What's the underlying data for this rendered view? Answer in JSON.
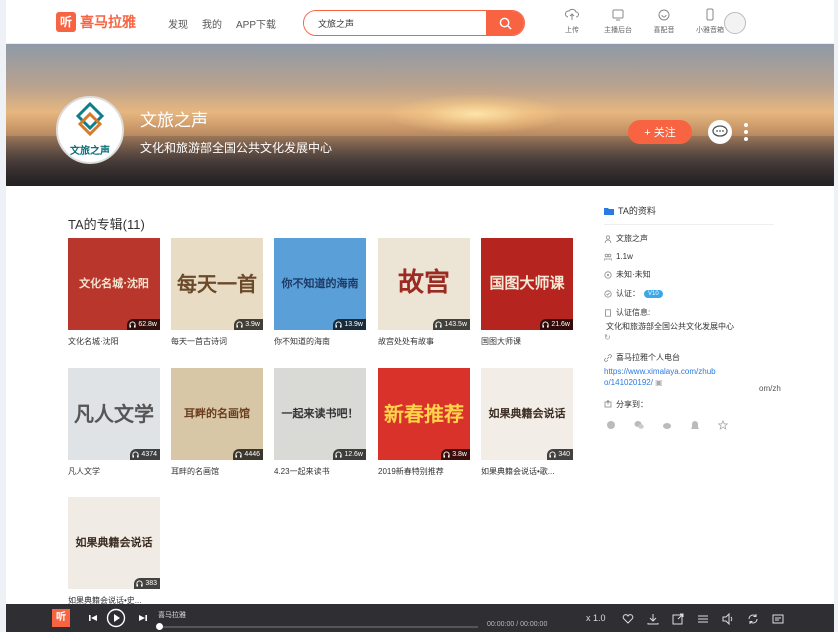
{
  "topbar": {
    "logo_mark": "听",
    "logo_text": "喜马拉雅",
    "nav": [
      "发现",
      "我的",
      "APP下载"
    ],
    "search_value": "文旅之声",
    "tools": [
      {
        "icon": "upload-icon",
        "label": "上传"
      },
      {
        "icon": "anchor-backend-icon",
        "label": "主播后台"
      },
      {
        "icon": "dubbing-icon",
        "label": "喜配音"
      },
      {
        "icon": "mini-program-icon",
        "label": "小雅音箱"
      }
    ]
  },
  "banner": {
    "avatar_text": "文旅之声",
    "title": "文旅之声",
    "subtitle": "文化和旅游部全国公共文化发展中心",
    "follow_label": "+ 关注"
  },
  "albums": {
    "heading": "TA的专辑(11)",
    "items": [
      {
        "title": "文化名城·沈阳",
        "count": "62.8w",
        "art": "文化名城·沈阳",
        "bg": "#b8362c",
        "fg": "#f3e6d0"
      },
      {
        "title": "每天一首古诗词",
        "count": "3.9w",
        "art": "每天一首",
        "bg": "#e8dcc4",
        "fg": "#6b4a2a"
      },
      {
        "title": "你不知道的海南",
        "count": "13.9w",
        "art": "你不知道的海南",
        "bg": "#5b9fd8",
        "fg": "#1d3b66"
      },
      {
        "title": "故宫处处有故事",
        "count": "143.5w",
        "art": "故宫",
        "bg": "#ece4d4",
        "fg": "#9a2a22"
      },
      {
        "title": "国图大师课",
        "count": "21.6w",
        "art": "国图大师课",
        "bg": "#b5241f",
        "fg": "#f6e9d6"
      },
      {
        "title": "凡人文学",
        "count": "4374",
        "art": "凡人文学",
        "bg": "#dfe3e6",
        "fg": "#555"
      },
      {
        "title": "耳畔的名画馆",
        "count": "4446",
        "art": "耳畔的名画馆",
        "bg": "#d8c7a6",
        "fg": "#6a3d1e"
      },
      {
        "title": "4.23一起来读书",
        "count": "12.6w",
        "art": "一起来读书吧！",
        "bg": "#d9d9d6",
        "fg": "#333"
      },
      {
        "title": "2019新春特别推荐",
        "count": "3.8w",
        "art": "新春推荐",
        "bg": "#d8322a",
        "fg": "#ffd34a"
      },
      {
        "title": "如果典籍会说话•歌...",
        "count": "340",
        "art": "如果典籍会说话",
        "bg": "#f2ede6",
        "fg": "#3b2d22"
      },
      {
        "title": "如果典籍会说话•史...",
        "count": "383",
        "art": "如果典籍会说话",
        "bg": "#f0ebe4",
        "fg": "#3b2d22"
      }
    ]
  },
  "profile": {
    "heading": "TA的资料",
    "name": "文旅之声",
    "fans": "1.1w",
    "location": "未知·未知",
    "verify_label": "认证：",
    "verify_badge": "V10",
    "verify_info_label": "认证信息:",
    "verify_info": "文化和旅游部全国公共文化发展中心",
    "radio_label": "喜马拉雅个人电台",
    "radio_url_1": "https://www.ximalaya.com/zhub",
    "radio_url_2": "o/141020192/",
    "share_label": "分享到：",
    "stray": "om/zh"
  },
  "player": {
    "logo": "听",
    "title": "喜马拉雅",
    "time": "00:00:00 / 00:00:00",
    "speed": "x 1.0"
  },
  "colors": {
    "accent": "#f86442",
    "player_bg": "#2e2e33",
    "link": "#2a7be0"
  }
}
